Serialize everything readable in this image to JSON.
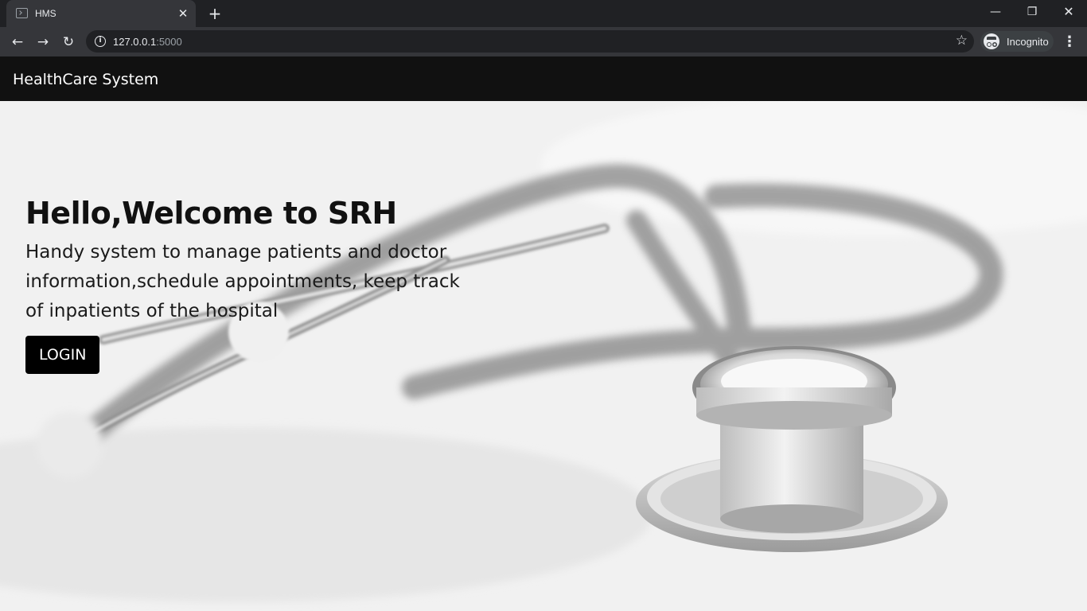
{
  "browser": {
    "tab": {
      "title": "HMS",
      "close_glyph": "✕"
    },
    "new_tab_glyph": "+",
    "window_controls": {
      "minimize": "—",
      "maximize": "❐",
      "close": "✕"
    },
    "nav": {
      "back": "←",
      "forward": "→",
      "reload": "↻"
    },
    "address": {
      "host": "127.0.0.1",
      "port": ":5000"
    },
    "profile": {
      "label": "Incognito"
    },
    "icons": {
      "info": "info-icon",
      "bookmark": "star-icon",
      "incognito": "incognito-icon",
      "menu": "more-vert-icon"
    },
    "colors": {
      "frame": "#202124",
      "toolbar": "#35363a",
      "text": "#e8eaed"
    }
  },
  "page": {
    "navbar": {
      "brand": "HealthCare System"
    },
    "hero": {
      "title": "Hello,Welcome to SRH",
      "subtitle": "Handy system to manage patients and doctor information,schedule appointments, keep track of inpatients of the hospital",
      "login_label": "LOGIN",
      "background": "stethoscope-photo"
    },
    "colors": {
      "navbar": "#111111",
      "button": "#000000",
      "button_text": "#ffffff"
    }
  }
}
